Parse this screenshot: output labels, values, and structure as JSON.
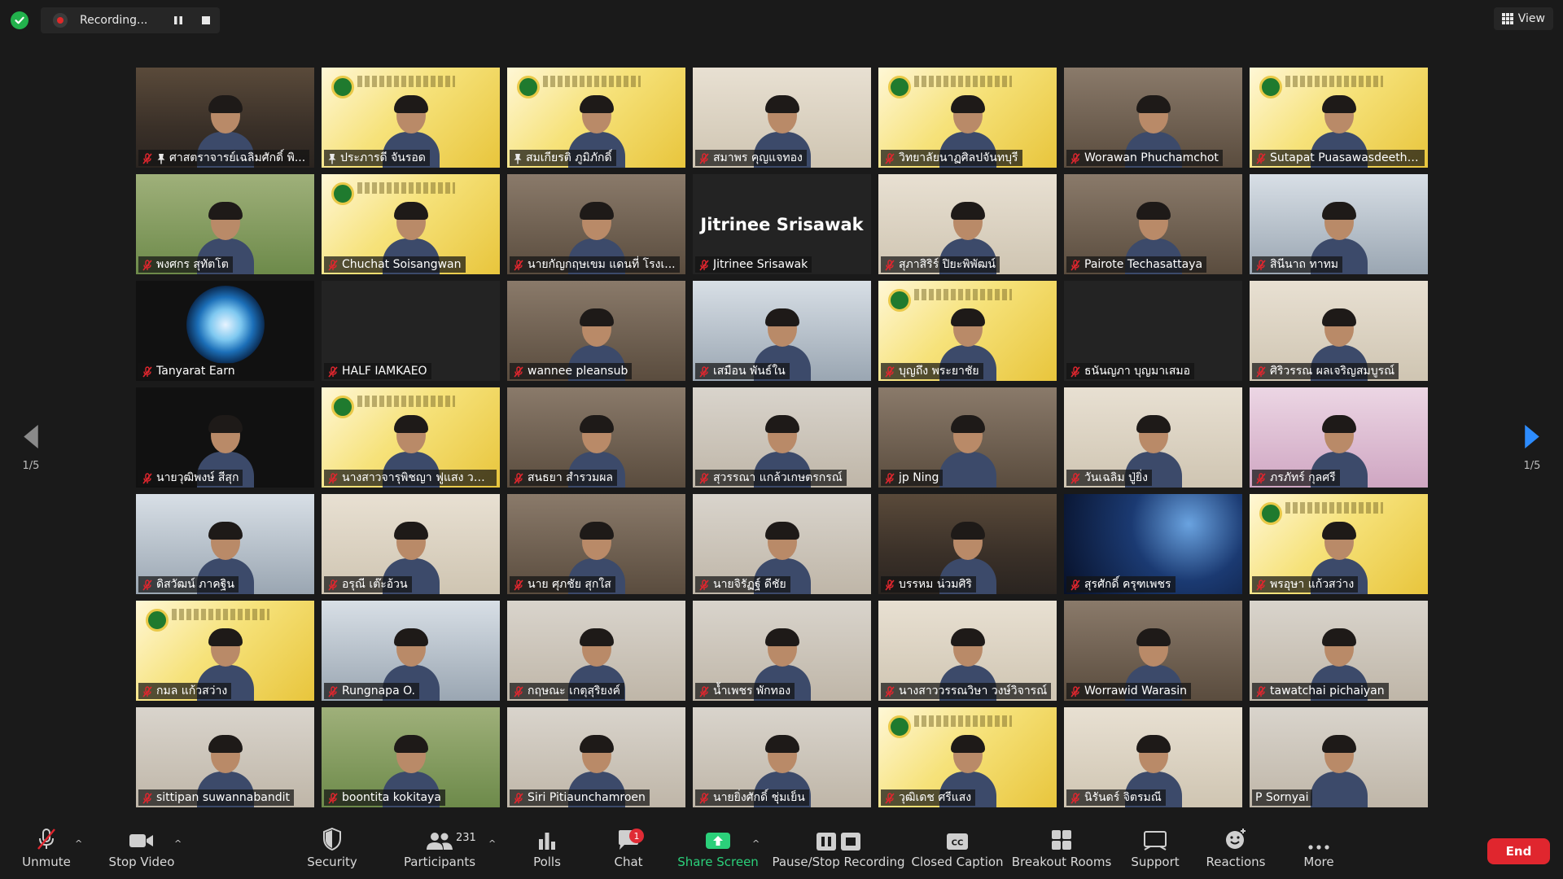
{
  "recording": {
    "label": "Recording..."
  },
  "view": {
    "label": "View"
  },
  "pagination": {
    "left": "1/5",
    "right": "1/5"
  },
  "participants": [
    {
      "name": "ศาสตราจารย์เฉลิมศักดิ์ พิ...",
      "scene": "office",
      "pinned": true,
      "muted": true,
      "active": false
    },
    {
      "name": "ประภารดี จันรอด",
      "scene": "banner",
      "pinned": true,
      "muted": false,
      "active": false
    },
    {
      "name": "สมเกียรติ ภูมิภักดิ์",
      "scene": "banner",
      "pinned": true,
      "muted": false,
      "active": true
    },
    {
      "name": "สมาพร คุญแจทอง",
      "scene": "wall",
      "pinned": false,
      "muted": true,
      "active": false
    },
    {
      "name": "วิทยาลัยนาฏศิลปจันทบุรี",
      "scene": "banner",
      "pinned": false,
      "muted": true,
      "active": false
    },
    {
      "name": "Worawan Phuchamchot",
      "scene": "room",
      "pinned": false,
      "muted": true,
      "active": false
    },
    {
      "name": "Sutapat Puasawasdeethep",
      "scene": "banner",
      "pinned": false,
      "muted": true,
      "active": false
    },
    {
      "name": "พงศกร สุทัตโต",
      "scene": "garden",
      "pinned": false,
      "muted": true,
      "active": false
    },
    {
      "name": "Chuchat Soisangwan",
      "scene": "banner",
      "pinned": false,
      "muted": true,
      "active": false
    },
    {
      "name": "นายกัญกฤษเขม แดนที่ โรงเ...",
      "scene": "room",
      "pinned": false,
      "muted": true,
      "active": false
    },
    {
      "name": "Jitrinee Srisawak",
      "scene": "name",
      "pinned": false,
      "muted": true,
      "active": false
    },
    {
      "name": "สุภาสิริร์ ปิยะพิพัฒน์",
      "scene": "wall",
      "pinned": false,
      "muted": true,
      "active": false
    },
    {
      "name": "Pairote Techasattaya",
      "scene": "room",
      "pinned": false,
      "muted": true,
      "active": false
    },
    {
      "name": "สินีนาถ ทาทม",
      "scene": "window",
      "pinned": false,
      "muted": true,
      "active": false
    },
    {
      "name": "Tanyarat Earn",
      "scene": "camlogo",
      "pinned": false,
      "muted": true,
      "active": false
    },
    {
      "name": "HALF IAMKAEO",
      "scene": "empty",
      "pinned": false,
      "muted": true,
      "active": false
    },
    {
      "name": "wannee pleansub",
      "scene": "room",
      "pinned": false,
      "muted": true,
      "active": false
    },
    {
      "name": "เสมือน พันธ์ใน",
      "scene": "window",
      "pinned": false,
      "muted": true,
      "active": false
    },
    {
      "name": "บุญถึง พระยาชัย",
      "scene": "banner",
      "pinned": false,
      "muted": true,
      "active": false
    },
    {
      "name": "ธนันญภา บุญมาเสมอ",
      "scene": "empty",
      "pinned": false,
      "muted": true,
      "active": false
    },
    {
      "name": "ศิริวรรณ ผลเจริญสมบูรณ์",
      "scene": "wall",
      "pinned": false,
      "muted": true,
      "active": false
    },
    {
      "name": "นายวุฒิพงษ์ สีสุก",
      "scene": "dark",
      "pinned": false,
      "muted": true,
      "active": false
    },
    {
      "name": "นางสาวจารุพิชญา ฟูแสง วนศ...",
      "scene": "banner",
      "pinned": false,
      "muted": true,
      "active": false
    },
    {
      "name": "สนธยา สำรวมผล",
      "scene": "room",
      "pinned": false,
      "muted": true,
      "active": false
    },
    {
      "name": "สุวรรณา แกล้วเกษตรกรณ์",
      "scene": "light",
      "pinned": false,
      "muted": true,
      "active": false
    },
    {
      "name": "jp Ning",
      "scene": "room",
      "pinned": false,
      "muted": true,
      "active": false
    },
    {
      "name": "วันเฉลิม ปู่ยิ่ง",
      "scene": "wall",
      "pinned": false,
      "muted": true,
      "active": false
    },
    {
      "name": "ภรภัทร์ กุลศรี",
      "scene": "pink",
      "pinned": false,
      "muted": true,
      "active": false
    },
    {
      "name": "ดิสวัฒน์ ภาคฐิน",
      "scene": "window",
      "pinned": false,
      "muted": true,
      "active": false
    },
    {
      "name": "อรุณี เต๊ะอ้วน",
      "scene": "wall",
      "pinned": false,
      "muted": true,
      "active": false
    },
    {
      "name": "นาย ศุภชัย สุกใส",
      "scene": "room",
      "pinned": false,
      "muted": true,
      "active": false
    },
    {
      "name": "นายจิรัฏฐ์ ดีชัย",
      "scene": "light",
      "pinned": false,
      "muted": true,
      "active": false
    },
    {
      "name": "บรรหม น่วมศิริ",
      "scene": "office",
      "pinned": false,
      "muted": true,
      "active": false
    },
    {
      "name": "สุรศักดิ์ ครุฑเพชร",
      "scene": "space",
      "pinned": false,
      "muted": true,
      "active": false
    },
    {
      "name": "พรอุษา แก้วสว่าง",
      "scene": "banner",
      "pinned": false,
      "muted": true,
      "active": false
    },
    {
      "name": "กมล แก้วสว่าง",
      "scene": "banner",
      "pinned": false,
      "muted": true,
      "active": false
    },
    {
      "name": "Rungnapa O.",
      "scene": "window",
      "pinned": false,
      "muted": true,
      "active": false
    },
    {
      "name": "กฤษณะ เกตุสุริยงค์",
      "scene": "light",
      "pinned": false,
      "muted": true,
      "active": false
    },
    {
      "name": "น้ำเพชร พักทอง",
      "scene": "light",
      "pinned": false,
      "muted": true,
      "active": false
    },
    {
      "name": "นางสาววรรณวิษา วงษ์วิจารณ์",
      "scene": "wall",
      "pinned": false,
      "muted": true,
      "active": false
    },
    {
      "name": "Worrawid Warasin",
      "scene": "room",
      "pinned": false,
      "muted": true,
      "active": false
    },
    {
      "name": "tawatchai pichaiyan",
      "scene": "light",
      "pinned": false,
      "muted": true,
      "active": false
    },
    {
      "name": "sittipan suwannabandit",
      "scene": "light",
      "pinned": false,
      "muted": true,
      "active": false
    },
    {
      "name": "boontita kokitaya",
      "scene": "garden",
      "pinned": false,
      "muted": true,
      "active": false
    },
    {
      "name": "Siri Pitiaunchamroen",
      "scene": "light",
      "pinned": false,
      "muted": true,
      "active": false
    },
    {
      "name": "นายยิ่งศักดิ์ ชุ่มเย็น",
      "scene": "light",
      "pinned": false,
      "muted": true,
      "active": false
    },
    {
      "name": "วุฒิเดช ศรีแสง",
      "scene": "banner",
      "pinned": false,
      "muted": true,
      "active": false
    },
    {
      "name": "นิรันดร์ จิตรมณี",
      "scene": "wall",
      "pinned": false,
      "muted": true,
      "active": false
    },
    {
      "name": "P Sornyai",
      "scene": "light",
      "pinned": false,
      "muted": false,
      "active": false
    }
  ],
  "toolbar": {
    "unmute": "Unmute",
    "stop_video": "Stop Video",
    "security": "Security",
    "participants": "Participants",
    "participants_count": "231",
    "polls": "Polls",
    "chat": "Chat",
    "chat_badge": "1",
    "share_screen": "Share Screen",
    "pause_stop_recording": "Pause/Stop Recording",
    "closed_caption": "Closed Caption",
    "breakout_rooms": "Breakout Rooms",
    "support": "Support",
    "reactions": "Reactions",
    "more": "More",
    "end": "End"
  },
  "colors": {
    "background": "#1a1a1a",
    "active_speaker": "#c6e83a",
    "share_green": "#2bd07a",
    "end_red": "#e0262e",
    "muted_red": "#e0262e"
  }
}
